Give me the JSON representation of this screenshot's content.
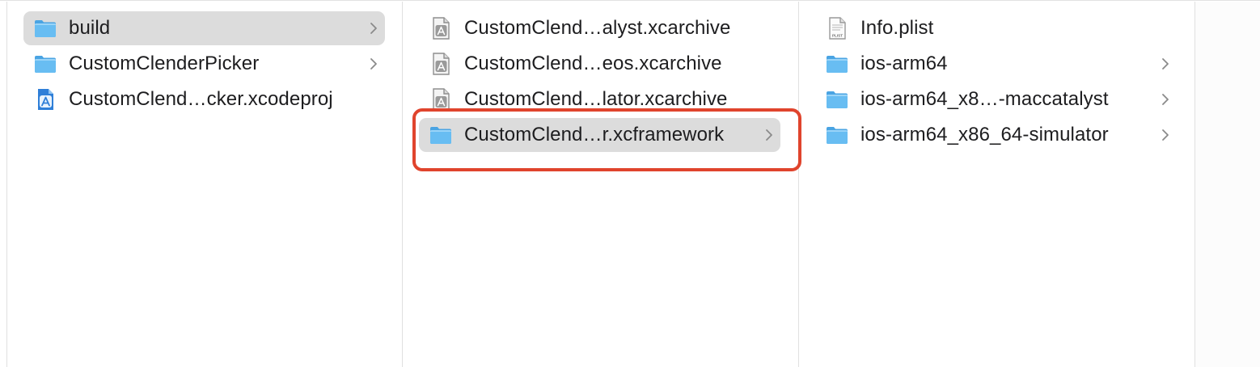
{
  "columns": [
    {
      "items": [
        {
          "label": "build",
          "icon": "folder-icon",
          "chevron": true,
          "selected": true
        },
        {
          "label": "CustomClenderPicker",
          "icon": "folder-icon",
          "chevron": true,
          "selected": false
        },
        {
          "label": "CustomClend…cker.xcodeproj",
          "icon": "xcode-project-icon",
          "chevron": false,
          "selected": false
        }
      ]
    },
    {
      "items": [
        {
          "label": "CustomClend…alyst.xcarchive",
          "icon": "xcarchive-icon",
          "chevron": false,
          "selected": false
        },
        {
          "label": "CustomClend…eos.xcarchive",
          "icon": "xcarchive-icon",
          "chevron": false,
          "selected": false
        },
        {
          "label": "CustomClend…lator.xcarchive",
          "icon": "xcarchive-icon",
          "chevron": false,
          "selected": false
        },
        {
          "label": "CustomClend…r.xcframework",
          "icon": "folder-icon",
          "chevron": true,
          "selected": true
        }
      ]
    },
    {
      "items": [
        {
          "label": "Info.plist",
          "icon": "plist-file-icon",
          "chevron": false,
          "selected": false
        },
        {
          "label": "ios-arm64",
          "icon": "folder-icon",
          "chevron": true,
          "selected": false
        },
        {
          "label": "ios-arm64_x8…-maccatalyst",
          "icon": "folder-icon",
          "chevron": true,
          "selected": false
        },
        {
          "label": "ios-arm64_x86_64-simulator",
          "icon": "folder-icon",
          "chevron": true,
          "selected": false
        }
      ]
    }
  ],
  "icons": {
    "plist_badge": "PLIST"
  },
  "colors": {
    "selection": "#dcdcdc",
    "highlight": "#e0442d",
    "folder_front": "#62b8f0",
    "folder_back": "#4aa4e3"
  }
}
